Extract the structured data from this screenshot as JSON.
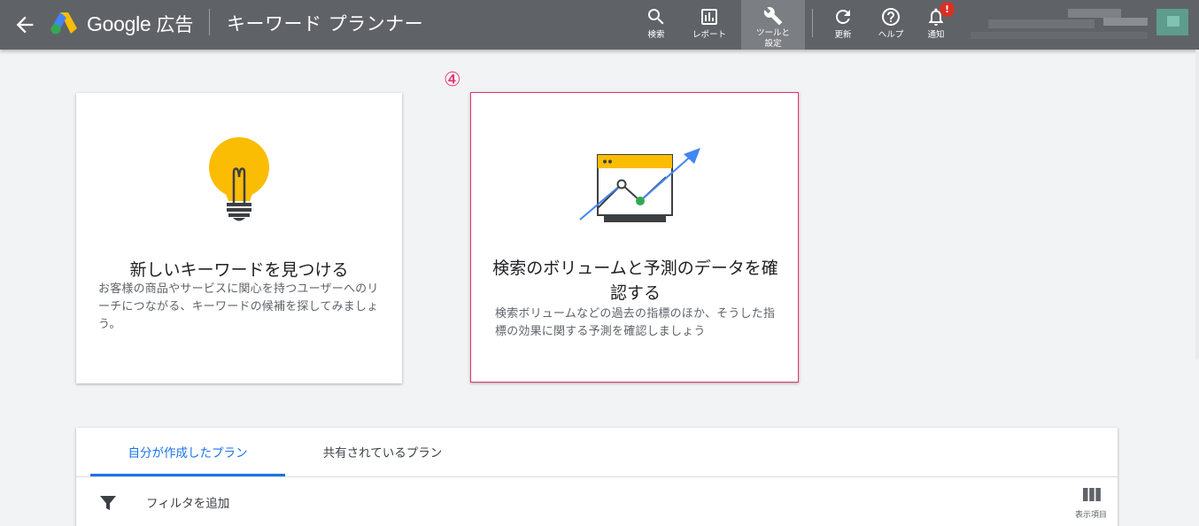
{
  "topbar": {
    "brand_google": "Google",
    "brand_ads": "広告",
    "page_title": "キーワード プランナー",
    "tools": {
      "search": "検索",
      "reports": "レポート",
      "tools_settings": "ツールと\n設定",
      "refresh": "更新",
      "help": "ヘルプ",
      "notifications": "通知"
    },
    "notification_badge": "!"
  },
  "annotation": "④",
  "cards": [
    {
      "title": "新しいキーワードを見つける",
      "description": "お客様の商品やサービスに関心を持つユーザーへのリーチにつながる、キーワードの候補を探してみましょう。",
      "icon": "lightbulb-icon"
    },
    {
      "title": "検索のボリュームと予測のデータを確認する",
      "description": "検索ボリュームなどの過去の指標のほか、そうした指標の効果に関する予測を確認しましょう",
      "icon": "forecast-chart-icon"
    }
  ],
  "plans": {
    "tabs": [
      "自分が作成したプラン",
      "共有されているプラン"
    ],
    "active_tab": 0,
    "filter_label": "フィルタを追加",
    "columns_label": "表示項目"
  },
  "colors": {
    "topbar": "#5f6368",
    "accent_blue": "#1a73e8",
    "highlight_pink": "#e8336a",
    "bulb_yellow": "#fbbc04",
    "badge_red": "#d93025"
  }
}
